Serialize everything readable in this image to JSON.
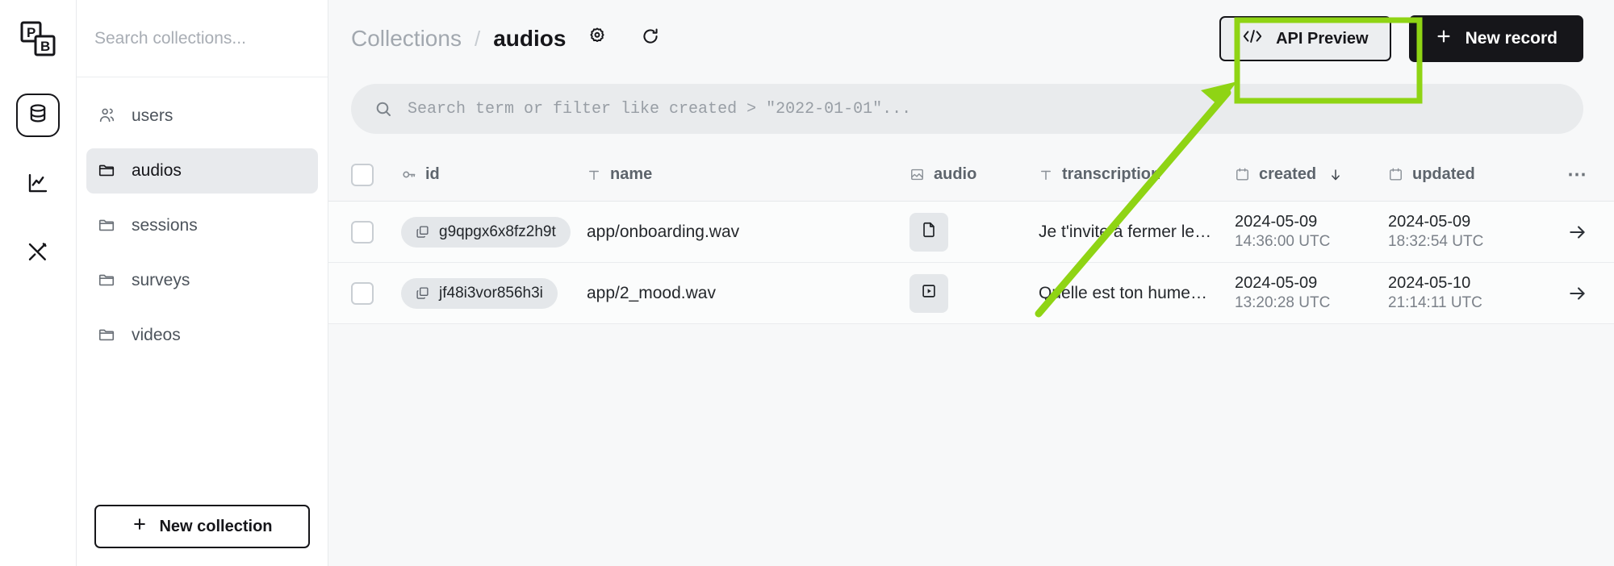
{
  "app": {
    "logo_text_top": "P",
    "logo_text_bottom": "B"
  },
  "rail": {
    "items": [
      {
        "name": "collections-nav",
        "icon": "database-icon",
        "active": true
      },
      {
        "name": "logs-nav",
        "icon": "chart-line-icon",
        "active": false
      },
      {
        "name": "settings-nav",
        "icon": "tools-icon",
        "active": false
      }
    ]
  },
  "sidebar": {
    "search": {
      "placeholder": "Search collections...",
      "value": ""
    },
    "items": [
      {
        "label": "users",
        "icon": "users-icon",
        "active": false
      },
      {
        "label": "audios",
        "icon": "folder-icon",
        "active": true
      },
      {
        "label": "sessions",
        "icon": "folder-icon",
        "active": false
      },
      {
        "label": "surveys",
        "icon": "folder-icon",
        "active": false
      },
      {
        "label": "videos",
        "icon": "folder-icon",
        "active": false
      }
    ],
    "new_collection_label": "New collection"
  },
  "header": {
    "breadcrumb_root": "Collections",
    "breadcrumb_separator": "/",
    "breadcrumb_current": "audios",
    "settings_icon": "gear-icon",
    "refresh_icon": "refresh-icon",
    "api_preview_label": "API Preview",
    "api_preview_icon": "code-icon",
    "new_record_label": "New record",
    "new_record_icon": "plus-icon"
  },
  "search": {
    "placeholder": "Search term or filter like created > \"2022-01-01\"...",
    "value": "",
    "icon": "search-icon"
  },
  "table": {
    "columns": [
      {
        "key": "id",
        "label": "id",
        "icon": "key-icon",
        "sorted": false
      },
      {
        "key": "name",
        "label": "name",
        "icon": "text-icon",
        "sorted": false
      },
      {
        "key": "audio",
        "label": "audio",
        "icon": "image-icon",
        "sorted": false
      },
      {
        "key": "transcription",
        "label": "transcription",
        "icon": "text-icon",
        "sorted": false
      },
      {
        "key": "created",
        "label": "created",
        "icon": "calendar-icon",
        "sorted": true,
        "sort_dir": "desc"
      },
      {
        "key": "updated",
        "label": "updated",
        "icon": "calendar-icon",
        "sorted": false
      }
    ],
    "more_label": "⋯",
    "rows": [
      {
        "id": "g9qpgx6x8fz2h9t",
        "name": "app/onboarding.wav",
        "audio_icon": "file-icon",
        "transcription": "Je t'invite à fermer les yeux et à suivre le son de ma v…",
        "created_date": "2024-05-09",
        "created_time": "14:36:00 UTC",
        "updated_date": "2024-05-09",
        "updated_time": "18:32:54 UTC"
      },
      {
        "id": "jf48i3vor856h3i",
        "name": "app/2_mood.wav",
        "audio_icon": "play-file-icon",
        "transcription": "Quelle est ton humeur du jour ?",
        "created_date": "2024-05-09",
        "created_time": "13:20:28 UTC",
        "updated_date": "2024-05-10",
        "updated_time": "21:14:11 UTC"
      }
    ]
  },
  "annotation": {
    "highlight_color": "#8fd414",
    "target": "api-preview-button"
  },
  "colors": {
    "accent_dark": "#16161a",
    "page_bg": "#f7f8f9",
    "panel_bg": "#ffffff",
    "active_item_bg": "#e8eaed",
    "pill_bg": "#e4e7ea"
  }
}
